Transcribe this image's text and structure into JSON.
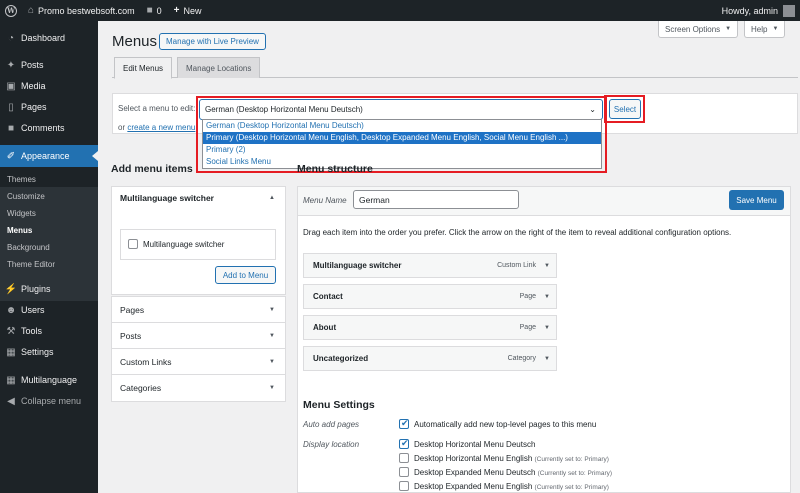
{
  "adminbar": {
    "site_name": "Promo bestwebsoft.com",
    "comments_count": "0",
    "new_label": "New",
    "howdy": "Howdy, admin"
  },
  "sidebar": {
    "items": [
      {
        "label": "Dashboard",
        "icon": "dashboard-icon"
      },
      {
        "label": "Posts",
        "icon": "pin-icon"
      },
      {
        "label": "Media",
        "icon": "media-icon"
      },
      {
        "label": "Pages",
        "icon": "page-icon"
      },
      {
        "label": "Comments",
        "icon": "comment-icon"
      },
      {
        "label": "Appearance",
        "icon": "brush-icon"
      },
      {
        "label": "Plugins",
        "icon": "plug-icon"
      },
      {
        "label": "Users",
        "icon": "user-icon"
      },
      {
        "label": "Tools",
        "icon": "wrench-icon"
      },
      {
        "label": "Settings",
        "icon": "settings-icon"
      },
      {
        "label": "Multilanguage",
        "icon": "multilanguage-icon"
      },
      {
        "label": "Collapse menu",
        "icon": "collapse-icon"
      }
    ],
    "submenu": [
      "Themes",
      "Customize",
      "Widgets",
      "Menus",
      "Background",
      "Theme Editor"
    ]
  },
  "header": {
    "title": "Menus",
    "live_preview": "Manage with Live Preview",
    "screen_options": "Screen Options",
    "help": "Help"
  },
  "tabs": [
    "Edit Menus",
    "Manage Locations"
  ],
  "select_menu": {
    "label": "Select a menu to edit:",
    "current": "German (Desktop Horizontal Menu Deutsch)",
    "options": [
      "German (Desktop Horizontal Menu Deutsch)",
      "Primary (Desktop Horizontal Menu English, Desktop Expanded Menu English, Social Menu English ...)",
      "Primary (2)",
      "Social Links Menu"
    ],
    "select_button": "Select",
    "create_prefix": "or ",
    "create_link": "create a new menu"
  },
  "add_items": {
    "title": "Add menu items",
    "multilanguage_switcher": "Multilanguage switcher",
    "checkbox_label": "Multilanguage switcher",
    "add_button": "Add to Menu",
    "sections": [
      "Pages",
      "Posts",
      "Custom Links",
      "Categories"
    ]
  },
  "structure": {
    "title": "Menu structure",
    "menu_name_label": "Menu Name",
    "menu_name_value": "German",
    "save_button": "Save Menu",
    "instructions": "Drag each item into the order you prefer. Click the arrow on the right of the item to reveal additional configuration options.",
    "items": [
      {
        "title": "Multilanguage switcher",
        "type": "Custom Link"
      },
      {
        "title": "Contact",
        "type": "Page"
      },
      {
        "title": "About",
        "type": "Page"
      },
      {
        "title": "Uncategorized",
        "type": "Category"
      }
    ]
  },
  "settings": {
    "title": "Menu Settings",
    "auto_add_label": "Auto add pages",
    "auto_add_text": "Automatically add new top-level pages to this menu",
    "display_location_label": "Display location",
    "locations": [
      {
        "name": "Desktop Horizontal Menu Deutsch",
        "note": "",
        "checked": true
      },
      {
        "name": "Desktop Horizontal Menu English",
        "note": "(Currently set to: Primary)",
        "checked": false
      },
      {
        "name": "Desktop Expanded Menu Deutsch",
        "note": "(Currently set to: Primary)",
        "checked": false
      },
      {
        "name": "Desktop Expanded Menu English",
        "note": "(Currently set to: Primary)",
        "checked": false
      }
    ]
  },
  "colors": {
    "accent": "#2271b1",
    "sidebar_bg": "#1d2327",
    "highlight": "#e51c23"
  }
}
